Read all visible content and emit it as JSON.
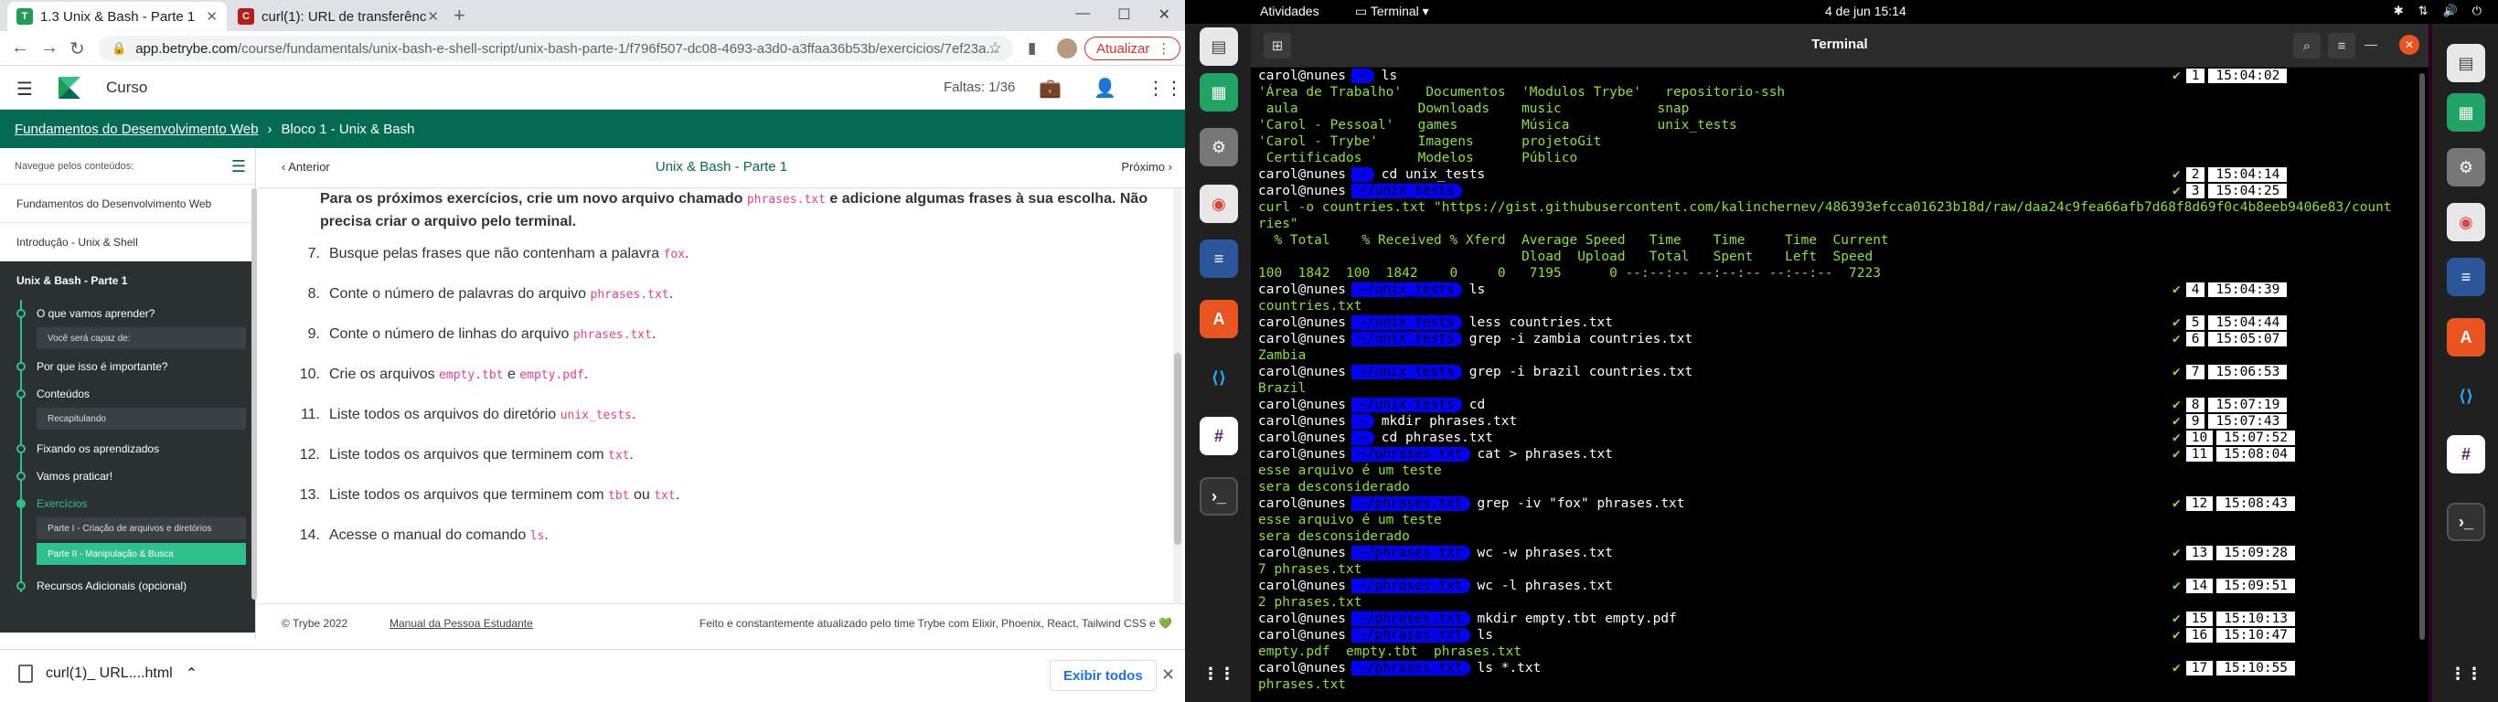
{
  "chrome": {
    "tabs": [
      {
        "title": "1.3 Unix & Bash - Parte 1"
      },
      {
        "title": "curl(1): URL de transferênc"
      }
    ],
    "new_tab": "+",
    "address": {
      "host": "app.betrybe.com",
      "path": "/course/fundamentals/unix-bash-e-shell-script/unix-bash-parte-1/f796f507-dc08-4693-a3d0-a3ffaa36b53b/exercicios/7ef23a..."
    },
    "update_label": "Atualizar"
  },
  "trybe": {
    "header": {
      "course_label": "Curso",
      "faltas": "Faltas: 1/36"
    },
    "breadcrumb": {
      "root": "Fundamentos do Desenvolvimento Web",
      "current": "Bloco 1 - Unix & Bash"
    },
    "sidebar": {
      "heading": "Navegue pelos conteúdos:",
      "items": [
        "Fundamentos do Desenvolvimento Web",
        "Introdução - Unix & Shell"
      ],
      "active_title": "Unix & Bash - Parte 1",
      "subitems": [
        {
          "label": "O que vamos aprender?",
          "child": "Você será capaz de:"
        },
        {
          "label": "Por que isso é importante?",
          "child": ""
        },
        {
          "label": "Conteúdos",
          "child": "Recapitulando"
        },
        {
          "label": "Fixando os aprendizados",
          "child": ""
        },
        {
          "label": "Vamos praticar!",
          "child": ""
        },
        {
          "label": "Exercícios",
          "child": ""
        }
      ],
      "exercise_children": [
        "Parte I - Criação de arquivos e diretórios",
        "Parte II - Manipulação & Busca"
      ],
      "last_item": "Recursos Adicionais (opcional)"
    },
    "lesson_nav": {
      "prev": "Anterior",
      "title": "Unix & Bash - Parte 1",
      "next": "Próximo"
    },
    "content": {
      "intro_before": "Para os próximos exercícios, crie um novo arquivo chamado ",
      "intro_code": "phrases.txt",
      "intro_after": " e adicione algumas frases à sua escolha. Não precisa criar o arquivo pelo terminal.",
      "items": [
        {
          "num": "7.",
          "text": "Busque pelas frases que não contenham a palavra ",
          "code": "fox",
          "tail": ".",
          "code2": "",
          "tail2": ""
        },
        {
          "num": "8.",
          "text": "Conte o número de palavras do arquivo ",
          "code": "phrases.txt",
          "tail": ".",
          "code2": "",
          "tail2": ""
        },
        {
          "num": "9.",
          "text": "Conte o número de linhas do arquivo ",
          "code": "phrases.txt",
          "tail": ".",
          "code2": "",
          "tail2": ""
        },
        {
          "num": "10.",
          "text": "Crie os arquivos ",
          "code": "empty.tbt",
          "tail": " e ",
          "code2": "empty.pdf",
          "tail2": "."
        },
        {
          "num": "11.",
          "text": "Liste todos os arquivos do diretório ",
          "code": "unix_tests",
          "tail": ".",
          "code2": "",
          "tail2": ""
        },
        {
          "num": "12.",
          "text": "Liste todos os arquivos que terminem com ",
          "code": "txt",
          "tail": ".",
          "code2": "",
          "tail2": ""
        },
        {
          "num": "13.",
          "text": "Liste todos os arquivos que terminem com ",
          "code": "tbt",
          "tail": " ou ",
          "code2": "txt",
          "tail2": "."
        },
        {
          "num": "14.",
          "text": "Acesse o manual do comando ",
          "code": "ls",
          "tail": ".",
          "code2": "",
          "tail2": ""
        }
      ]
    },
    "footer": {
      "copyright": "© Trybe 2022",
      "manual": "Manual da Pessoa Estudante",
      "built": "Feito e constantemente atualizado pelo time Trybe com Elixir, Phoenix, React, Tailwind CSS e 💚"
    }
  },
  "download": {
    "filename": "curl(1)_ URL....html",
    "show_all": "Exibir todos"
  },
  "ubuntu": {
    "activities": "Atividades",
    "app_menu": "Terminal",
    "clock": "4 de jun  15:14",
    "terminal_title": "Terminal"
  },
  "terminal": {
    "lines": [
      {
        "type": "prompt",
        "user": "carol@nunes",
        "dir": "~",
        "cmd": "ls",
        "n": "1",
        "time": "15:04:02"
      },
      {
        "type": "out",
        "text": "'Área de Trabalho'   Documentos  'Modulos Trybe'   repositorio-ssh"
      },
      {
        "type": "out",
        "text": " aula               Downloads    music            snap"
      },
      {
        "type": "out",
        "text": "'Carol - Pessoal'   games        Música           unix_tests"
      },
      {
        "type": "out",
        "text": "'Carol - Trybe'     Imagens      projetoGit"
      },
      {
        "type": "out",
        "text": " Certificados       Modelos      Público"
      },
      {
        "type": "prompt",
        "user": "carol@nunes",
        "dir": "~",
        "cmd": "cd unix_tests",
        "n": "2",
        "time": "15:04:14"
      },
      {
        "type": "prompt",
        "user": "carol@nunes",
        "dir": "~/unix_tests",
        "cmd": "",
        "n": "3",
        "time": "15:04:25"
      },
      {
        "type": "out",
        "text": "curl -o countries.txt \"https://gist.githubusercontent.com/kalinchernev/486393efcca01623b18d/raw/daa24c9fea66afb7d68f8d69f0c4b8eeb9406e83/count"
      },
      {
        "type": "out",
        "text": "ries\""
      },
      {
        "type": "out",
        "text": "  % Total    % Received % Xferd  Average Speed   Time    Time     Time  Current"
      },
      {
        "type": "out",
        "text": "                                 Dload  Upload   Total   Spent    Left  Speed"
      },
      {
        "type": "out",
        "text": "100  1842  100  1842    0     0   7195      0 --:--:-- --:--:-- --:--:--  7223"
      },
      {
        "type": "prompt",
        "user": "carol@nunes",
        "dir": "~/unix_tests",
        "cmd": "ls",
        "n": "4",
        "time": "15:04:39"
      },
      {
        "type": "out",
        "text": "countries.txt"
      },
      {
        "type": "prompt",
        "user": "carol@nunes",
        "dir": "~/unix_tests",
        "cmd": "less countries.txt",
        "n": "5",
        "time": "15:04:44"
      },
      {
        "type": "prompt",
        "user": "carol@nunes",
        "dir": "~/unix_tests",
        "cmd": "grep -i zambia countries.txt",
        "n": "6",
        "time": "15:05:07"
      },
      {
        "type": "out",
        "text": "Zambia"
      },
      {
        "type": "prompt",
        "user": "carol@nunes",
        "dir": "~/unix_tests",
        "cmd": "grep -i brazil countries.txt",
        "n": "7",
        "time": "15:06:53"
      },
      {
        "type": "out",
        "text": "Brazil"
      },
      {
        "type": "prompt",
        "user": "carol@nunes",
        "dir": "~/unix_tests",
        "cmd": "cd",
        "n": "8",
        "time": "15:07:19"
      },
      {
        "type": "prompt",
        "user": "carol@nunes",
        "dir": "~",
        "cmd": "mkdir phrases.txt",
        "n": "9",
        "time": "15:07:43"
      },
      {
        "type": "prompt",
        "user": "carol@nunes",
        "dir": "~",
        "cmd": "cd phrases.txt",
        "n": "10",
        "time": "15:07:52"
      },
      {
        "type": "prompt",
        "user": "carol@nunes",
        "dir": "~/phrases.txt",
        "cmd": "cat > phrases.txt",
        "n": "11",
        "time": "15:08:04"
      },
      {
        "type": "out",
        "text": "esse arquivo é um teste"
      },
      {
        "type": "out",
        "text": "sera desconsiderado"
      },
      {
        "type": "prompt",
        "user": "carol@nunes",
        "dir": "~/phrases.txt",
        "cmd": "grep -iv \"fox\" phrases.txt",
        "n": "12",
        "time": "15:08:43"
      },
      {
        "type": "out",
        "text": "esse arquivo é um teste"
      },
      {
        "type": "out",
        "text": "sera desconsiderado"
      },
      {
        "type": "prompt",
        "user": "carol@nunes",
        "dir": "~/phrases.txt",
        "cmd": "wc -w phrases.txt",
        "n": "13",
        "time": "15:09:28"
      },
      {
        "type": "out",
        "text": "7 phrases.txt"
      },
      {
        "type": "prompt",
        "user": "carol@nunes",
        "dir": "~/phrases.txt",
        "cmd": "wc -l phrases.txt",
        "n": "14",
        "time": "15:09:51"
      },
      {
        "type": "out",
        "text": "2 phrases.txt"
      },
      {
        "type": "prompt",
        "user": "carol@nunes",
        "dir": "~/phrases.txt",
        "cmd": "mkdir empty.tbt empty.pdf",
        "n": "15",
        "time": "15:10:13"
      },
      {
        "type": "prompt",
        "user": "carol@nunes",
        "dir": "~/phrases.txt",
        "cmd": "ls",
        "n": "16",
        "time": "15:10:47"
      },
      {
        "type": "out",
        "text": "empty.pdf  empty.tbt  phrases.txt"
      },
      {
        "type": "prompt",
        "user": "carol@nunes",
        "dir": "~/phrases.txt",
        "cmd": "ls *.txt",
        "n": "17",
        "time": "15:10:55"
      },
      {
        "type": "out",
        "text": "phrases.txt"
      }
    ]
  }
}
